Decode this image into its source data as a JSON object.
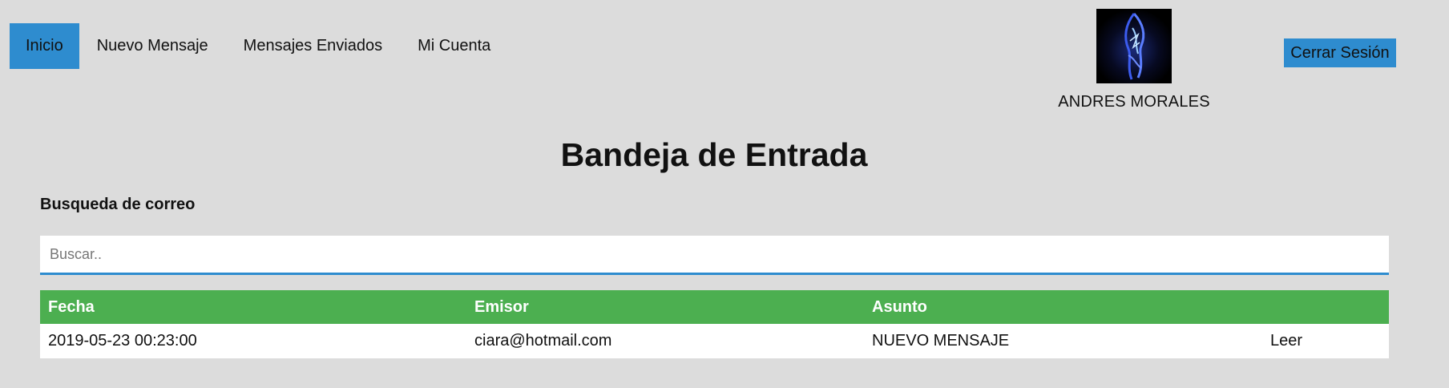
{
  "nav": {
    "items": [
      {
        "label": "Inicio",
        "active": true
      },
      {
        "label": "Nuevo Mensaje",
        "active": false
      },
      {
        "label": "Mensajes Enviados",
        "active": false
      },
      {
        "label": "Mi Cuenta",
        "active": false
      }
    ]
  },
  "user": {
    "name": "ANDRES MORALES",
    "avatar_icon": "blue-swirl-avatar"
  },
  "logout_label": "Cerrar Sesión",
  "title": "Bandeja de Entrada",
  "search": {
    "label": "Busqueda de correo",
    "placeholder": "Buscar..",
    "value": ""
  },
  "table": {
    "headers": [
      "Fecha",
      "Emisor",
      "Asunto",
      ""
    ],
    "rows": [
      {
        "fecha": "2019-05-23 00:23:00",
        "emisor": "ciara@hotmail.com",
        "asunto": "NUEVO MENSAJE",
        "action": "Leer"
      }
    ]
  },
  "colors": {
    "background": "#dcdcdc",
    "accent_blue": "#2e8ccf",
    "header_green": "#4caf50",
    "white": "#ffffff"
  }
}
